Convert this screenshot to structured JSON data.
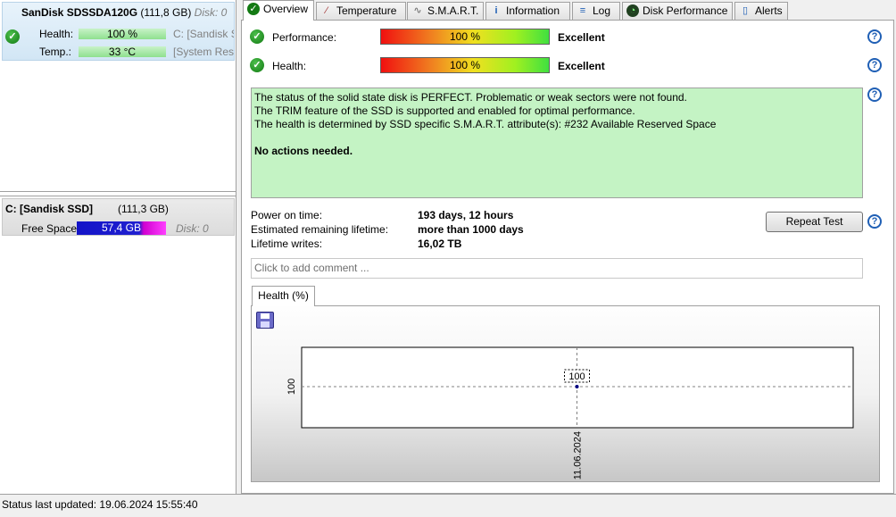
{
  "left": {
    "disk": {
      "name": "SanDisk SDSSDA120G",
      "size": "(111,8 GB)",
      "disk_index": "Disk: 0",
      "health_label": "Health:",
      "health_value": "100 %",
      "temp_label": "Temp.:",
      "temp_value": "33 °C",
      "side_line1": "C: [Sandisk SS",
      "side_line2": "[System Rese"
    },
    "partition": {
      "name": "C: [Sandisk SSD]",
      "size": "(111,3 GB)",
      "free_label": "Free Space",
      "free_value": "57,4 GB",
      "disk_index": "Disk: 0"
    }
  },
  "tabs": [
    {
      "label": "Overview",
      "icon": "check-icon"
    },
    {
      "label": "Temperature",
      "icon": "thermometer-icon"
    },
    {
      "label": "S.M.A.R.T.",
      "icon": "smart-icon"
    },
    {
      "label": "Information",
      "icon": "info-icon"
    },
    {
      "label": "Log",
      "icon": "log-icon"
    },
    {
      "label": "Disk Performance",
      "icon": "gauge-icon"
    },
    {
      "label": "Alerts",
      "icon": "alerts-icon"
    }
  ],
  "overview": {
    "performance_label": "Performance:",
    "performance_value": "100 %",
    "performance_rating": "Excellent",
    "health_label": "Health:",
    "health_value": "100 %",
    "health_rating": "Excellent",
    "status_lines": [
      "The status of the solid state disk is PERFECT. Problematic or weak sectors were not found.",
      "The TRIM feature of the SSD is supported and enabled for optimal performance.",
      "The health is determined by SSD specific S.M.A.R.T. attribute(s):  #232 Available Reserved Space"
    ],
    "status_action": "No actions needed.",
    "power_on_label": "Power on time:",
    "power_on_value": "193 days, 12 hours",
    "lifetime_label": "Estimated remaining lifetime:",
    "lifetime_value": "more than 1000 days",
    "writes_label": "Lifetime writes:",
    "writes_value": "16,02 TB",
    "repeat_button": "Repeat Test",
    "comment_placeholder": "Click to add comment ...",
    "chart_tab": "Health (%)",
    "help_glyph": "?"
  },
  "chart_data": {
    "type": "line",
    "x": [
      "11.06.2024"
    ],
    "values": [
      100
    ],
    "tick_labels_y": [
      "100"
    ],
    "point_label": "100",
    "grid": "dashed crosshair",
    "colors": {
      "point": "#000080",
      "grid": "#808080"
    }
  },
  "statusbar": {
    "text": "Status last updated: 19.06.2024 15:55:40"
  },
  "colors": {
    "status_box": "#c4f3c4",
    "help": "#1f5fb5",
    "check": "#137a13"
  }
}
